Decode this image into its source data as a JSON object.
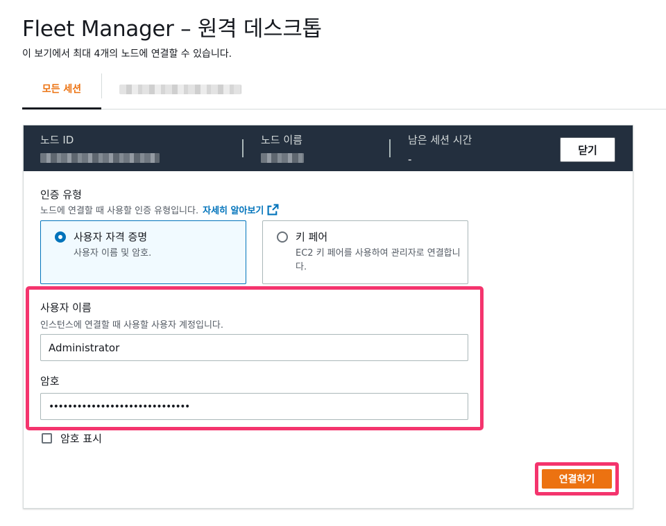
{
  "page": {
    "title": "Fleet Manager – 원격 데스크톱",
    "subtitle": "이 보기에서 최대 4개의 노드에 연결할 수 있습니다."
  },
  "tabs": [
    {
      "label": "모든 세션",
      "active": true
    },
    {
      "label": "",
      "active": false,
      "redacted": true
    }
  ],
  "session_header": {
    "node_id_label": "노드 ID",
    "node_name_label": "노드 이름",
    "remaining_time_label": "남은 세션 시간",
    "remaining_time_value": "-",
    "close_label": "닫기"
  },
  "auth": {
    "label": "인증 유형",
    "description": "노드에 연결할 때 사용할 인증 유형입니다.",
    "learn_more": "자세히 알아보기",
    "options": [
      {
        "title": "사용자 자격 증명",
        "description": "사용자 이름 및 암호.",
        "selected": true
      },
      {
        "title": "키 페어",
        "description": "EC2 키 페어를 사용하여 관리자로 연결합니다.",
        "selected": false
      }
    ]
  },
  "credentials": {
    "username_label": "사용자 이름",
    "username_description": "인스턴스에 연결할 때 사용할 사용자 계정입니다.",
    "username_value": "Administrator",
    "password_label": "암호",
    "password_value": "••••••••••••••••••••••••••••••",
    "show_password_label": "암호 표시",
    "show_password_checked": false
  },
  "connect_label": "연결하기",
  "colors": {
    "accent_orange": "#ec7211",
    "header_bg": "#232f3e",
    "link_blue": "#0073bb",
    "highlight_pink": "#f4346d"
  }
}
